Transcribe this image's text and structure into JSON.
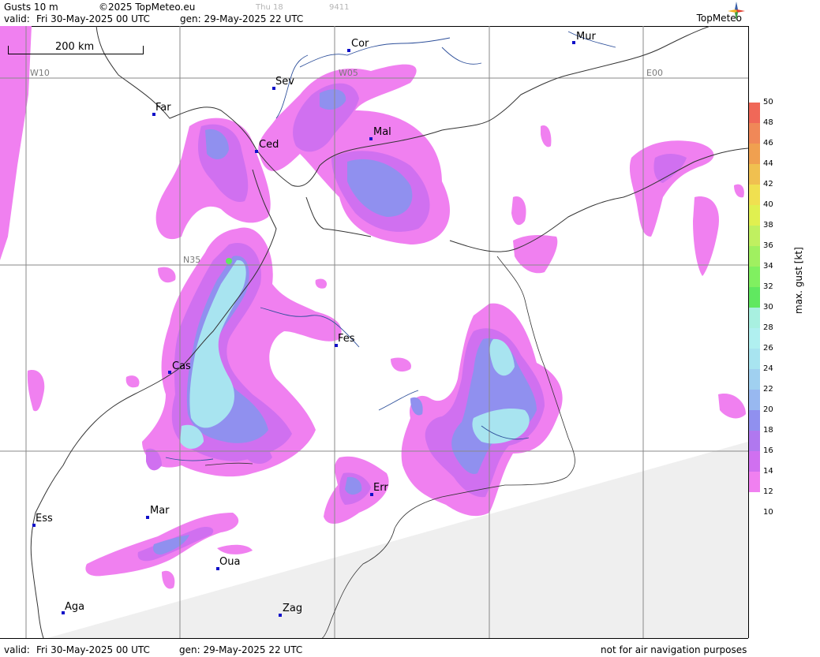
{
  "header": {
    "param": "Gusts 10 m",
    "copyright": "©2025 TopMeteo.eu",
    "day": "Thu 18",
    "code": "9411",
    "valid_label": "valid:",
    "valid_value": "Fri  30-May-2025  00 UTC",
    "gen_value": "gen: 29-May-2025 22 UTC",
    "brand": "TopMeteo"
  },
  "footer": {
    "valid_label": "valid:",
    "valid_value": "Fri  30-May-2025  00 UTC",
    "gen_value": "gen: 29-May-2025 22 UTC",
    "disclaimer": "not for air navigation purposes"
  },
  "scale_bar": {
    "label": "200 km"
  },
  "grid_labels": {
    "w10": "W10",
    "w05": "W05",
    "e00": "E00",
    "n35": "N35"
  },
  "cities": {
    "cor": "Cor",
    "mur": "Mur",
    "sev": "Sev",
    "far": "Far",
    "ced": "Ced",
    "mal": "Mal",
    "fes": "Fes",
    "cas": "Cas",
    "err": "Err",
    "mar": "Mar",
    "ess": "Ess",
    "oua": "Oua",
    "aga": "Aga",
    "zag": "Zag"
  },
  "legend": {
    "title": "max. gust [kt]",
    "ticks": [
      "50",
      "48",
      "46",
      "44",
      "42",
      "40",
      "38",
      "36",
      "34",
      "32",
      "30",
      "28",
      "26",
      "24",
      "22",
      "20",
      "18",
      "16",
      "14",
      "12",
      "10"
    ],
    "colors": {
      "b48_50": "#f06858",
      "b46_48": "#f08858",
      "b44_46": "#f0a050",
      "b42_44": "#f0c050",
      "b40_42": "#f0e050",
      "b38_40": "#e0f050",
      "b36_38": "#c0f060",
      "b34_36": "#a0f060",
      "b32_34": "#80f060",
      "b30_32": "#60e860",
      "b28_30": "#a8f0e0",
      "b26_28": "#b0f0f0",
      "b24_26": "#a8e4f0",
      "b22_24": "#a0d0f0",
      "b20_22": "#98b8f0",
      "b18_20": "#9090ef",
      "b16_18": "#b078ef",
      "b14_16": "#d070f0",
      "b12_14": "#f080f0"
    }
  }
}
